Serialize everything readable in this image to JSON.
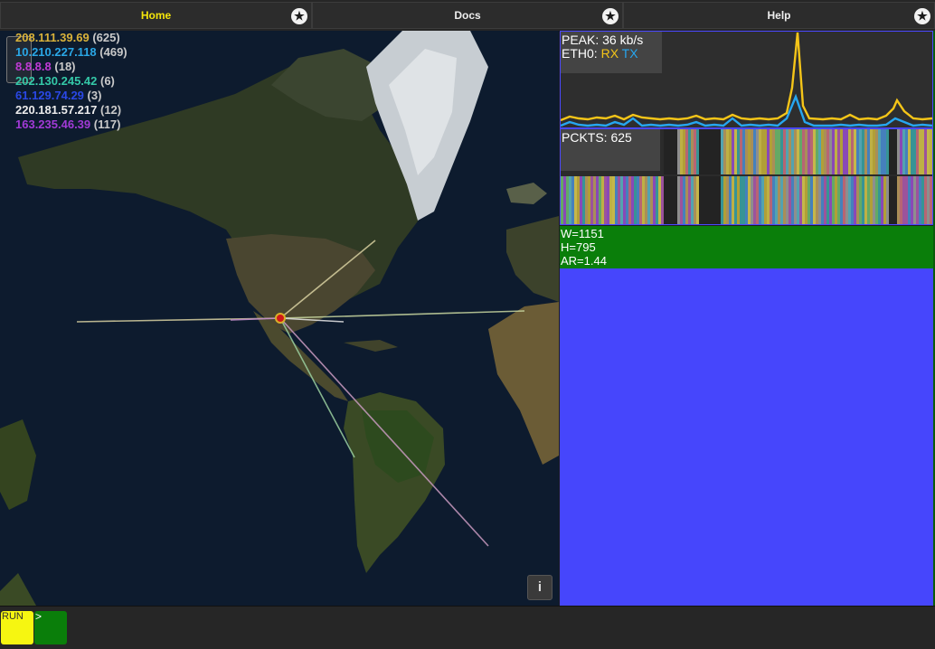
{
  "tabs": [
    {
      "label": "Home"
    },
    {
      "label": "Docs"
    },
    {
      "label": "Help"
    }
  ],
  "legend": [
    {
      "ip": "208.111.39.69",
      "count": "(625)",
      "color": "#d9b23a"
    },
    {
      "ip": "10.210.227.118",
      "count": "(469)",
      "color": "#2aa7e6"
    },
    {
      "ip": "8.8.8.8",
      "count": "(18)",
      "color": "#c03ad6"
    },
    {
      "ip": "202.130.245.42",
      "count": "(6)",
      "color": "#34c9a8"
    },
    {
      "ip": "61.129.74.29",
      "count": "(3)",
      "color": "#2a48e6"
    },
    {
      "ip": "220.181.57.217",
      "count": "(12)",
      "color": "#ececec"
    },
    {
      "ip": "163.235.46.39",
      "count": "(117)",
      "color": "#a13ad6"
    }
  ],
  "bandwidth": {
    "peak_label": "PEAK: 36 kb/s",
    "iface_label": "ETH0:",
    "rx_label": "RX",
    "tx_label": "TX",
    "rx_color": "#f5c518",
    "tx_color": "#26a6f0"
  },
  "packets": {
    "label": "PCKTS: 625"
  },
  "window_info": {
    "w": "W=1151",
    "h": "H=795",
    "ar": "AR=1.44"
  },
  "map": {
    "info_label": "i"
  },
  "command": {
    "run_label": "RUN",
    "prompt": ">"
  },
  "icons": {
    "star": "star-icon",
    "info": "info-icon",
    "zoom": "zoom-control-icon"
  }
}
